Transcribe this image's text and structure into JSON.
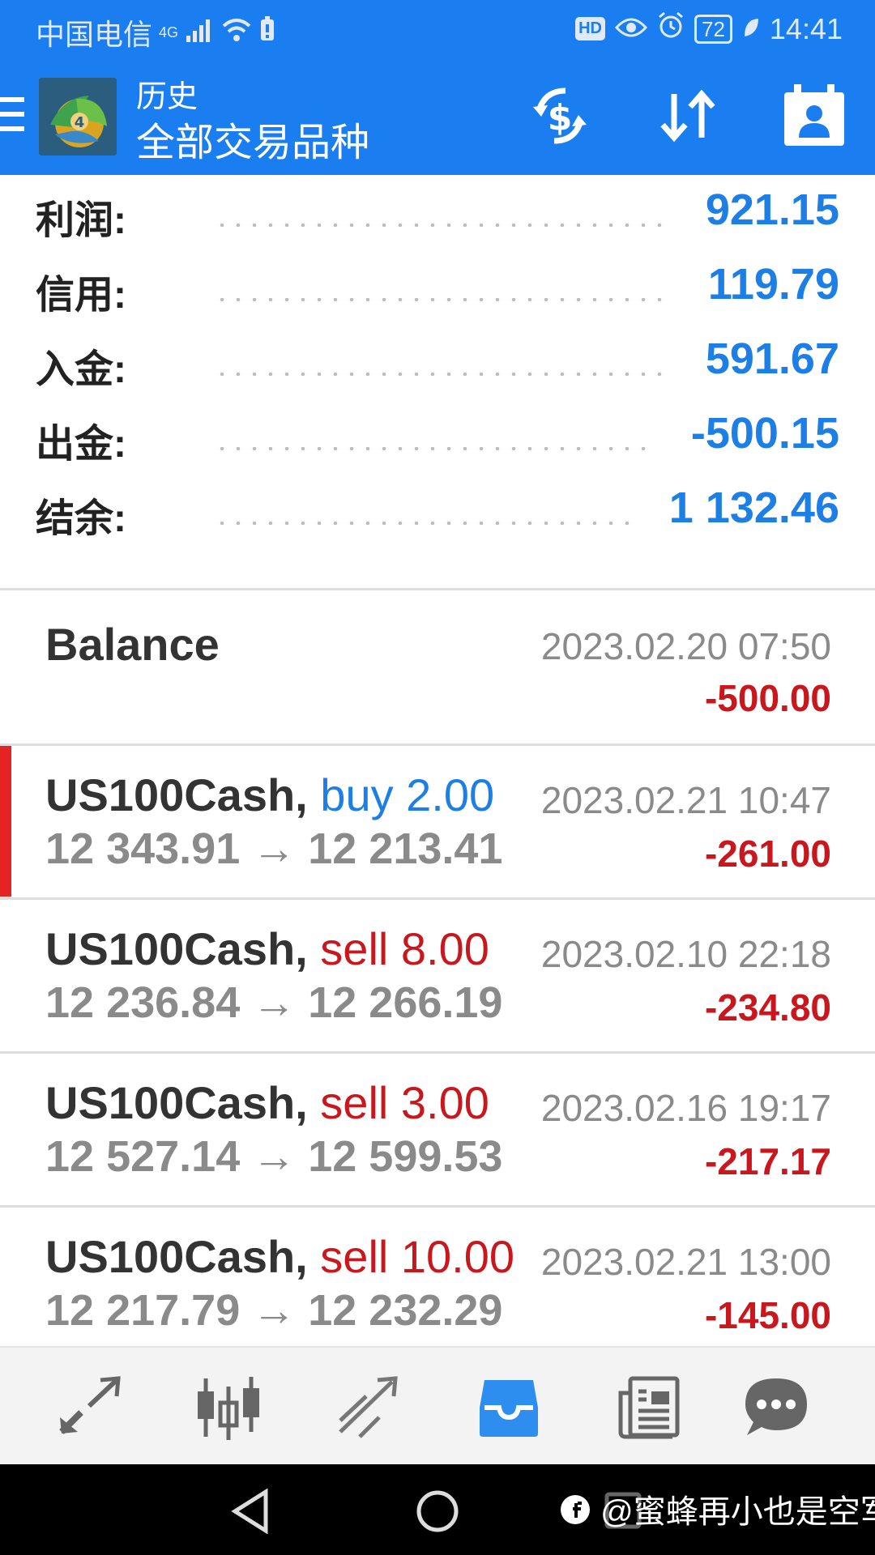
{
  "status_bar": {
    "carrier": "中国电信",
    "network": "4G",
    "hd_label": "HD",
    "battery": "72",
    "time": "14:41"
  },
  "app_bar": {
    "title": "历史",
    "subtitle": "全部交易品种",
    "icons": [
      "menu-icon",
      "metatrader-logo",
      "currency-exchange-icon",
      "sort-icon",
      "calendar-icon"
    ]
  },
  "summary": [
    {
      "label": "利润:",
      "value": "921.15"
    },
    {
      "label": "信用:",
      "value": "119.79"
    },
    {
      "label": "入金:",
      "value": "591.67"
    },
    {
      "label": "出金:",
      "value": "-500.15"
    },
    {
      "label": "结余:",
      "value": "1 132.46"
    }
  ],
  "transactions": [
    {
      "symbol": "Balance",
      "action": "",
      "prices": "",
      "time": "2023.02.20 07:50",
      "profit": "-500.00"
    },
    {
      "symbol": "US100Cash,",
      "action": "buy 2.00",
      "prices": "12 343.91 → 12 213.41",
      "time": "2023.02.21 10:47",
      "profit": "-261.00",
      "action_type": "buy",
      "selected": true
    },
    {
      "symbol": "US100Cash,",
      "action": "sell 8.00",
      "prices": "12 236.84 → 12 266.19",
      "time": "2023.02.10 22:18",
      "profit": "-234.80",
      "action_type": "sell"
    },
    {
      "symbol": "US100Cash,",
      "action": "sell 3.00",
      "prices": "12 527.14 → 12 599.53",
      "time": "2023.02.16 19:17",
      "profit": "-217.17",
      "action_type": "sell"
    },
    {
      "symbol": "US100Cash,",
      "action": "sell 10.00",
      "prices": "12 217.79 → 12 232.29",
      "time": "2023.02.21 13:00",
      "profit": "-145.00",
      "action_type": "sell"
    }
  ],
  "bottom_nav": [
    "quotes-icon",
    "chart-icon",
    "trade-icon",
    "history-icon",
    "news-icon",
    "chat-icon"
  ],
  "active_nav": "history-icon",
  "watermark": "@蜜蜂再小也是空军",
  "colors": {
    "primary": "#1a7ef0",
    "value_blue": "#1d7fe6",
    "buy_blue": "#1d7fe6",
    "sell_red": "#c8181e",
    "loss_red": "#c8181e",
    "selected_marker": "#e52323"
  }
}
